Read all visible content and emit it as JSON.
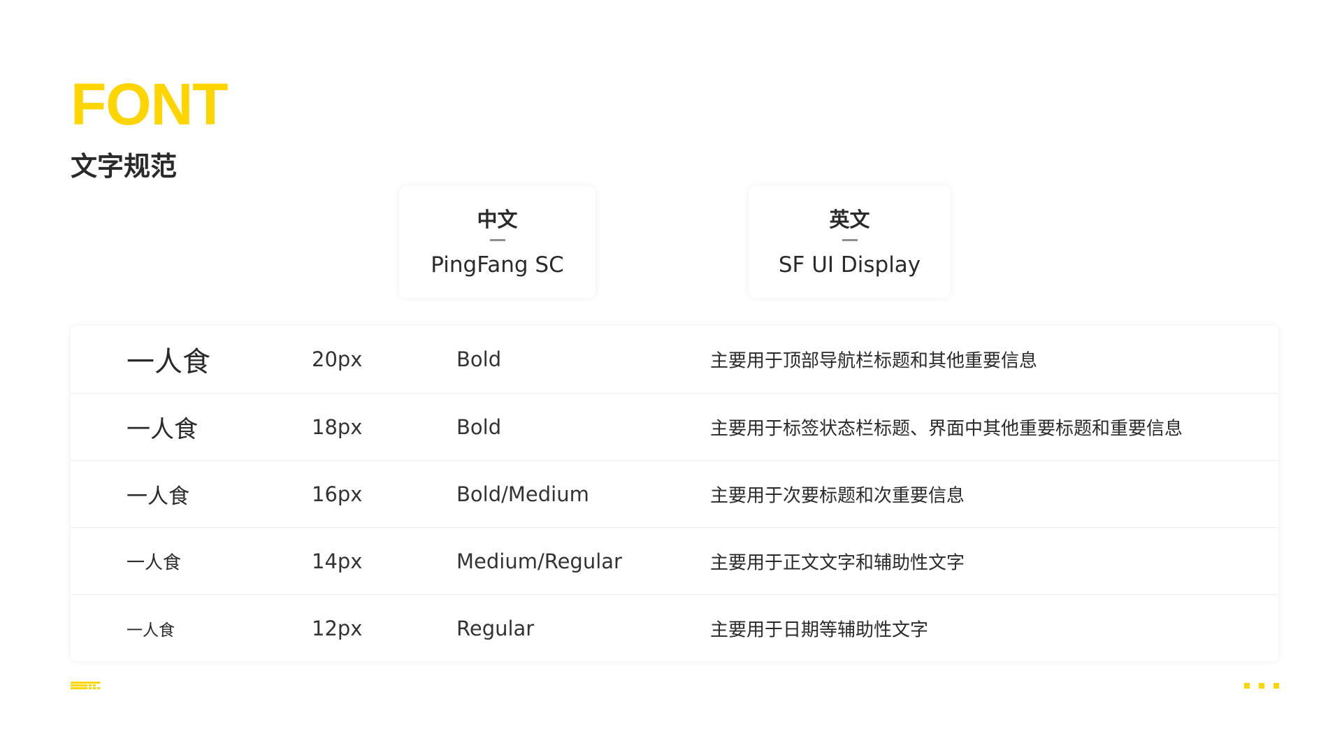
{
  "header": {
    "title": "FONT",
    "subtitle": "文字规范"
  },
  "font_cards": [
    {
      "label": "中文",
      "font": "PingFang SC"
    },
    {
      "label": "英文",
      "font": "SF UI Display"
    }
  ],
  "type_scale": {
    "rows": [
      {
        "sample": "一人食",
        "size": "20px",
        "weight": "Bold",
        "usage": "主要用于顶部导航栏标题和其他重要信息"
      },
      {
        "sample": "一人食",
        "size": "18px",
        "weight": "Bold",
        "usage": "主要用于标签状态栏标题、界面中其他重要标题和重要信息"
      },
      {
        "sample": "一人食",
        "size": "16px",
        "weight": "Bold/Medium",
        "usage": "主要用于次要标题和次重要信息"
      },
      {
        "sample": "一人食",
        "size": "14px",
        "weight": "Medium/Regular",
        "usage": "主要用于正文文字和辅助性文字"
      },
      {
        "sample": "一人食",
        "size": "12px",
        "weight": "Regular",
        "usage": "主要用于日期等辅助性文字"
      }
    ]
  },
  "colors": {
    "accent": "#ffd500",
    "text": "#2a2a2a",
    "divider": "#8f8f8f"
  }
}
